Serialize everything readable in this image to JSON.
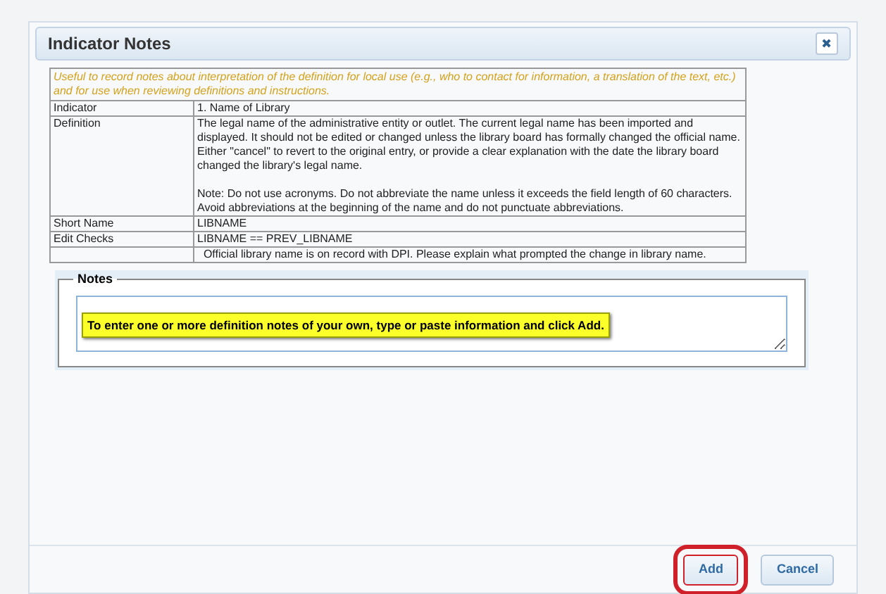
{
  "dialog": {
    "title": "Indicator Notes",
    "close": "✖"
  },
  "intro": "Useful to record notes about interpretation of the definition for local use (e.g., who to contact for information, a translation of the text, etc.) and for use when reviewing definitions and instructions.",
  "rows": [
    {
      "label": "Indicator",
      "paragraphs": [
        "1. Name of Library"
      ]
    },
    {
      "label": "Definition",
      "paragraphs": [
        "The legal name of the administrative entity or outlet. The current legal name has been imported and displayed. It should not be edited or changed unless the library board has formally changed the official name. Either \"cancel\" to revert to the original entry, or provide a clear explanation with the date the library board changed the library's legal name.",
        "Note: Do not use acronyms. Do not abbreviate the name unless it exceeds the field length of 60 characters. Avoid abbreviations at the beginning of the name and do not punctuate abbreviations."
      ]
    },
    {
      "label": "Short Name",
      "paragraphs": [
        "LIBNAME"
      ]
    },
    {
      "label": "Edit Checks",
      "paragraphs": [
        "LIBNAME == PREV_LIBNAME"
      ]
    },
    {
      "label": "",
      "paragraphs": [
        "  Official library name is on record with DPI. Please explain what prompted the change in library name."
      ]
    }
  ],
  "notes": {
    "legend": "Notes",
    "callout": "To enter one or more definition notes of your own, type or paste information and click Add."
  },
  "buttons": [
    {
      "label": "Add",
      "highlighted": true
    },
    {
      "label": "Cancel",
      "highlighted": false
    }
  ]
}
